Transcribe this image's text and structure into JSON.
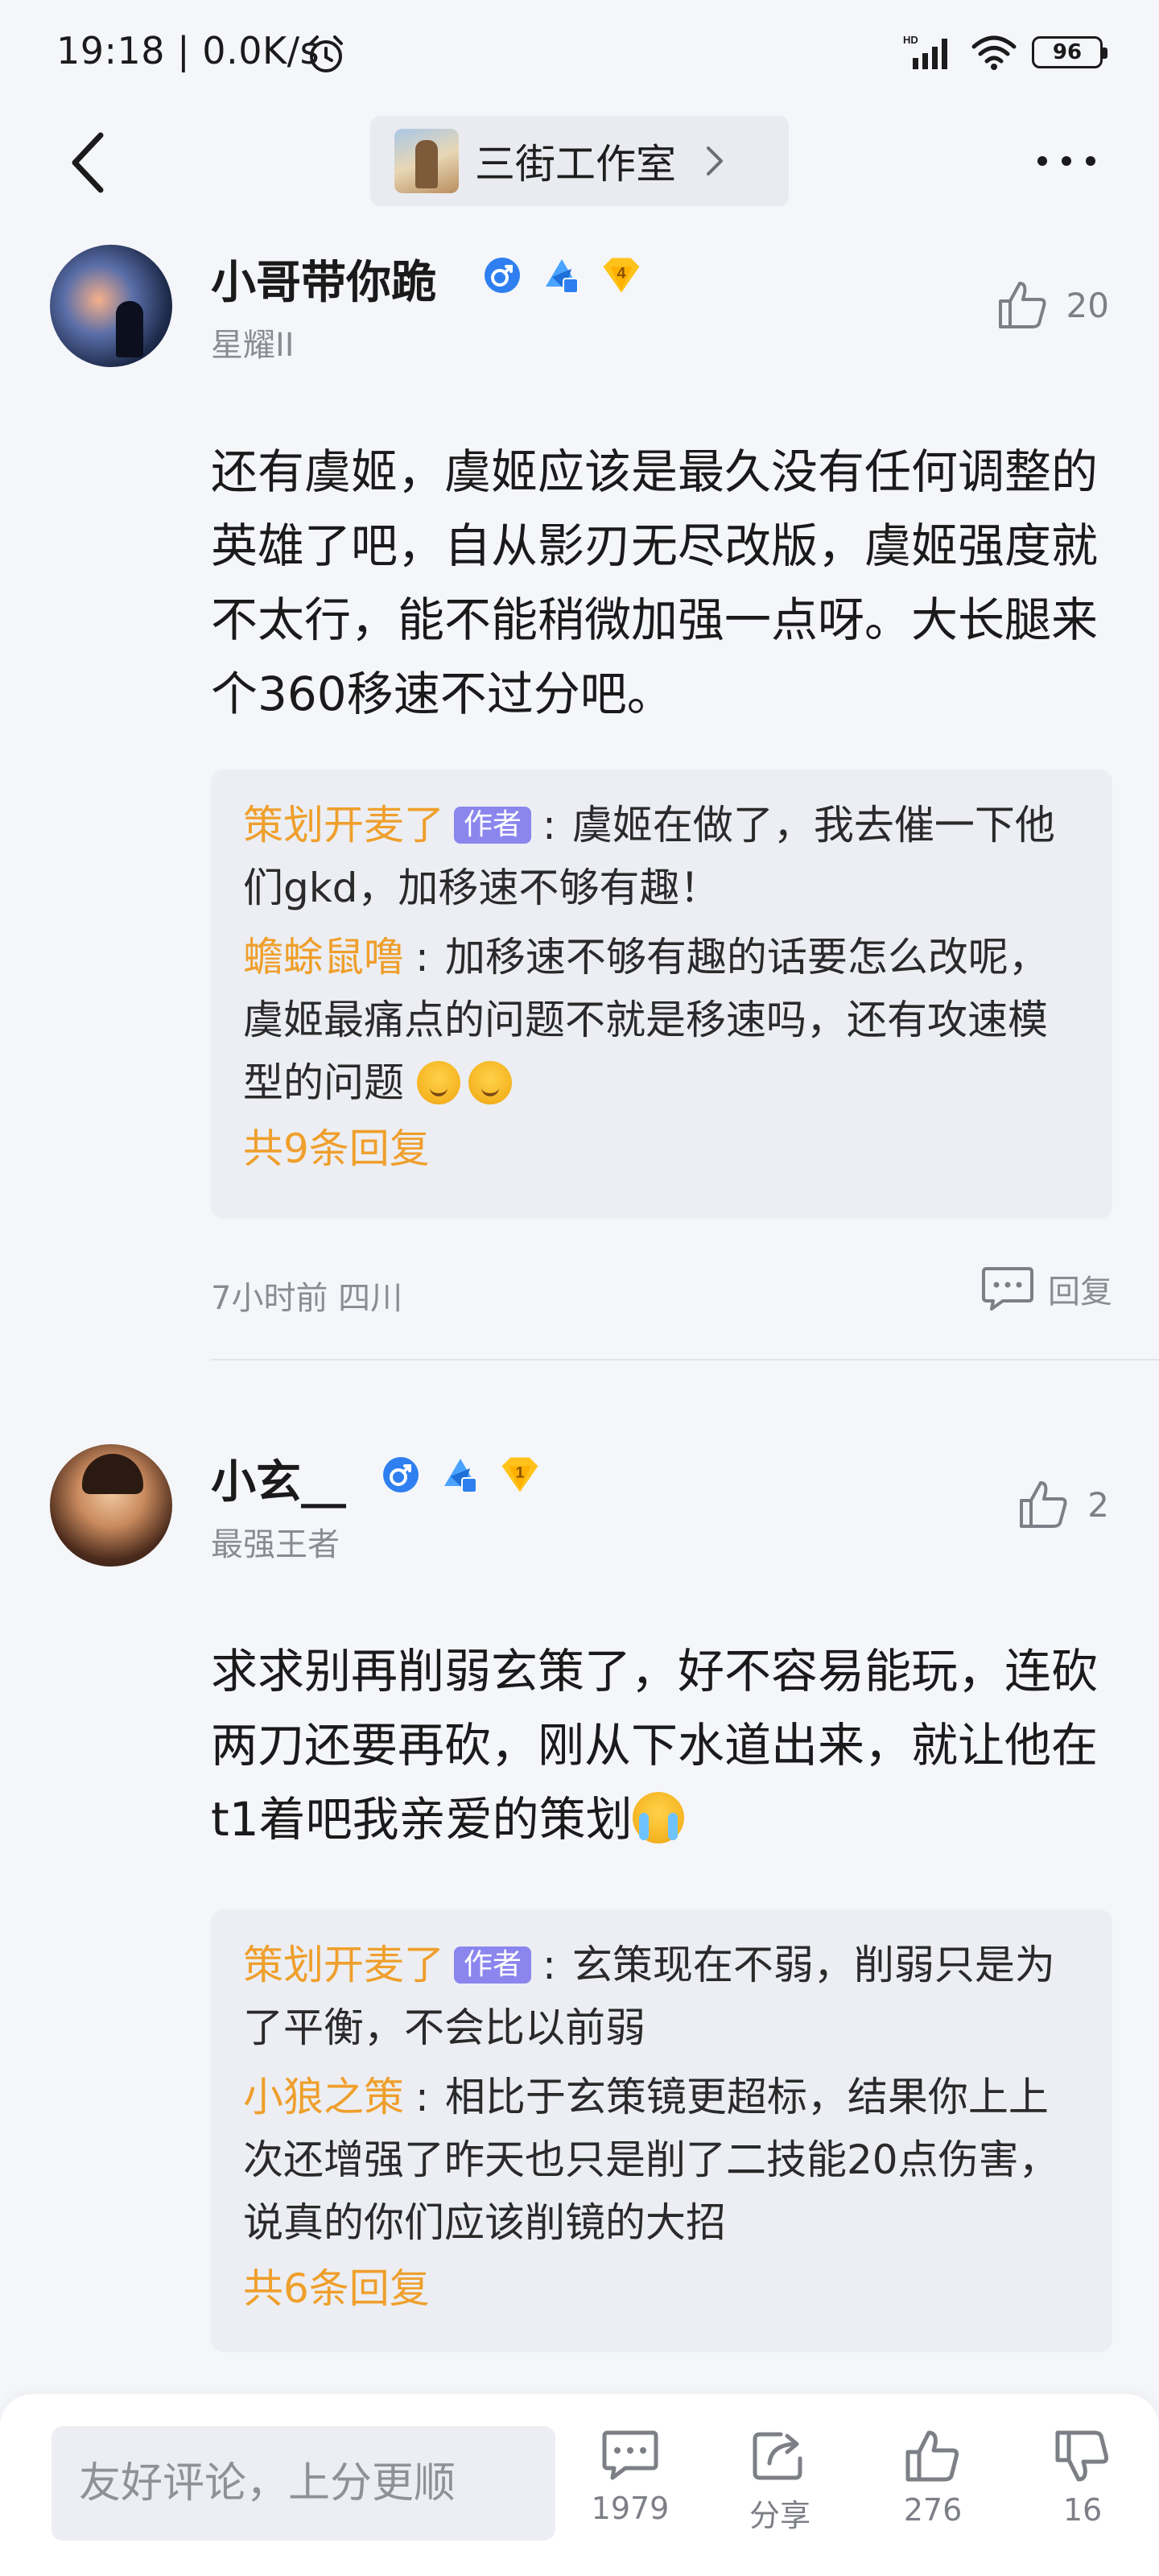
{
  "status_bar": {
    "time": "19:18 | 0.0K/s",
    "battery": "96"
  },
  "nav": {
    "channel_name": "三街工作室"
  },
  "comments": [
    {
      "username": "小哥带你跪",
      "rank": "星耀II",
      "likes": "20",
      "text": "还有虞姬，虞姬应该是最久没有任何调整的英雄了吧，自从影刃无尽改版，虞姬强度就不太行，能不能稍微加强一点呀。大长腿来个360移速不过分吧。",
      "rank_badge_number": "4",
      "replies": [
        {
          "author": "策划开麦了",
          "author_tag": "作者",
          "text": "虞姬在做了，我去催一下他们gkd，加移速不够有趣！"
        },
        {
          "author": "蟾蜍鼠噜",
          "text": "加移速不够有趣的话要怎么改呢，虞姬最痛点的问题不就是移速吗，还有攻速模型的问题"
        }
      ],
      "total_replies": "共9条回复",
      "time_location": "7小时前 四川",
      "reply_label": "回复"
    },
    {
      "username": "小玄__",
      "rank": "最强王者",
      "likes": "2",
      "text": "求求别再削弱玄策了，好不容易能玩，连砍两刀还要再砍，刚从下水道出来，就让他在t1着吧我亲爱的策划",
      "rank_badge_number": "1",
      "replies": [
        {
          "author": "策划开麦了",
          "author_tag": "作者",
          "text": "玄策现在不弱，削弱只是为了平衡，不会比以前弱"
        },
        {
          "author": "小狼之策",
          "text": "相比于玄策镜更超标，结果你上上次还增强了昨天也只是削了二技能20点伤害，说真的你们应该削镜的大招"
        }
      ],
      "total_replies": "共6条回复"
    }
  ],
  "bottom_bar": {
    "input_placeholder": "友好评论，上分更顺",
    "comment_count": "1979",
    "share_label": "分享",
    "like_count": "276",
    "dislike_count": "16"
  },
  "colors": {
    "accent_orange": "#ef9f2c",
    "author_tag": "#8b86ee",
    "gender_blue": "#2f7ff0"
  }
}
